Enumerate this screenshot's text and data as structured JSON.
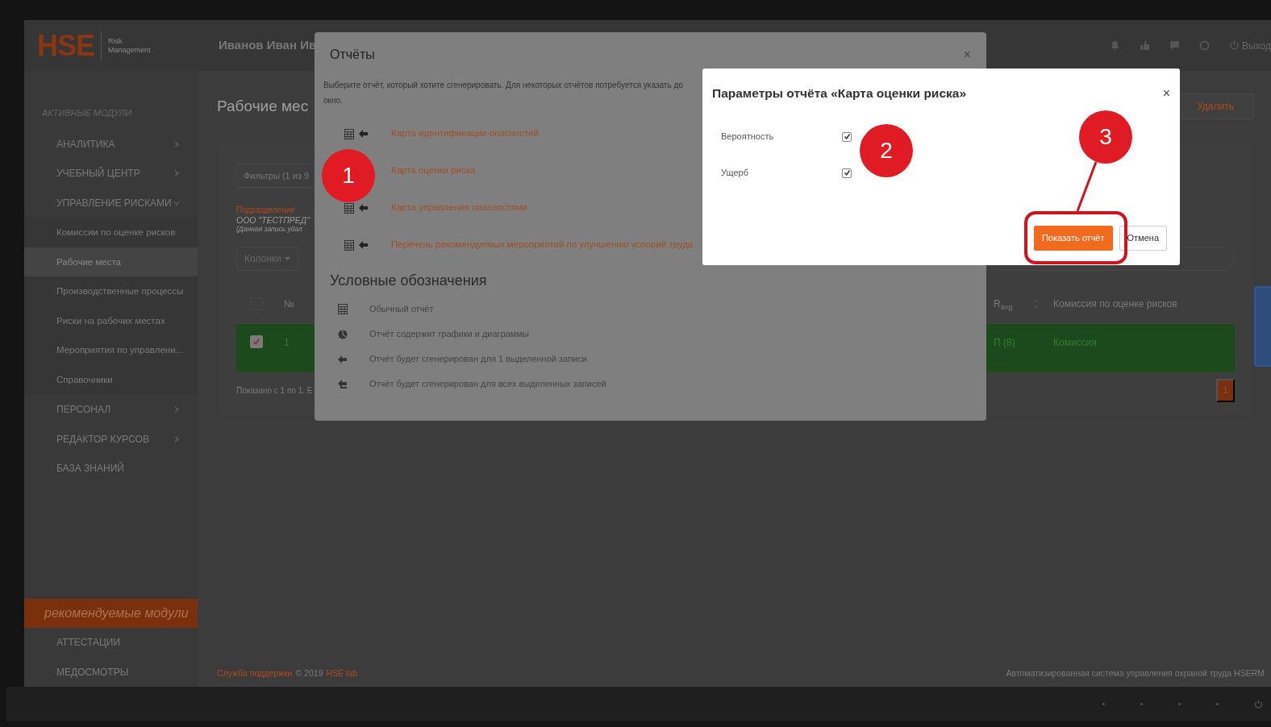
{
  "header": {
    "logo": "HSE",
    "logo_subtitle": [
      "Risk",
      "Management"
    ],
    "user": "Иванов Иван Ив",
    "logout": "Выход"
  },
  "sidebar": {
    "section_label": "АКТИВНЫЕ МОДУЛИ",
    "items": [
      {
        "label": "АНАЛИТИКА",
        "expanded": false,
        "selected": false
      },
      {
        "label": "УЧЕБНЫЙ ЦЕНТР",
        "expanded": false,
        "selected": false
      },
      {
        "label": "УПРАВЛЕНИЕ РИСКАМИ",
        "expanded": true,
        "selected": false,
        "children": [
          {
            "label": "Комиссии по оценке рисков",
            "selected": false
          },
          {
            "label": "Рабочие места",
            "selected": true
          },
          {
            "label": "Производственные процессы",
            "selected": false
          },
          {
            "label": "Риски на рабочих местах",
            "selected": false
          },
          {
            "label": "Мероприятия по управлени...",
            "selected": false
          },
          {
            "label": "Справочники",
            "selected": false
          }
        ]
      },
      {
        "label": "ПЕРСОНАЛ",
        "expanded": false,
        "selected": false
      },
      {
        "label": "РЕДАКТОР КУРСОВ",
        "expanded": false,
        "selected": false
      },
      {
        "label": "БАЗА ЗНАНИЙ",
        "selected": false
      }
    ],
    "recommended": {
      "label": "рекомендуемые модули",
      "items": [
        {
          "label": "АТТЕСТАЦИИ",
          "selected": false
        },
        {
          "label": "МЕДОСМОТРЫ",
          "selected": false
        }
      ]
    }
  },
  "page": {
    "title": "Рабочие мес",
    "delete_button": "Удалить",
    "filters_button": "Фильтры (1 из 9",
    "subdivision_label": "Подразделение",
    "subdivision_value": "ООО \"ТЕСТПРЕД\"",
    "subdivision_note": "(Данная запись удал",
    "columns_button": "Колонки",
    "table": {
      "header_checked": false,
      "columns": [
        "№",
        "R$_{avg}$",
        "Комиссия по оценке рисков"
      ],
      "rows": [
        {
          "selected": true,
          "checked": true,
          "cells": [
            "1",
            "П (8)",
            "Комиссия"
          ]
        }
      ]
    },
    "summary": "Показано с 1 по 1. Е",
    "pages": [
      {
        "label": "1",
        "selected": true
      }
    ]
  },
  "footer": {
    "support_link": "Служба поддержки",
    "copyright": "© 2019",
    "company_link": "HSE lab",
    "tagline": "Автоматизированная система управления охраной труда HSERM"
  },
  "reports_dialog": {
    "title": "Отчёты",
    "close": "×",
    "description_line1": "Выберите отчёт, который хотите сгенерировать. Для некоторых отчётов потребуется указать до",
    "description_line2": "окно.",
    "reports": [
      {
        "label": "Карта идентификации опасностей"
      },
      {
        "label": "Карта оценки риска"
      },
      {
        "label": "Карта управления опасностями"
      },
      {
        "label": "Перечень рекомендуемых мероприятий по улучшению условий труда"
      }
    ],
    "legend_title": "Условные обозначения",
    "legend": [
      {
        "kind": "table",
        "label": "Обычный отчёт"
      },
      {
        "kind": "chart",
        "label": "Отчёт содержит графики и диаграммы"
      },
      {
        "kind": "single",
        "label": "Отчёт будет сгенерирован для 1 выделенной записи"
      },
      {
        "kind": "multiple",
        "label": "Отчёт будет сгенерирован для всех выделенных записей"
      }
    ]
  },
  "params_dialog": {
    "title": "Параметры отчёта «Карта оценки риска»",
    "close": "×",
    "params": [
      {
        "label": "Вероятность",
        "checked": true
      },
      {
        "label": "Ущерб",
        "checked": true
      }
    ],
    "primary_button": "Показать отчёт",
    "cancel_button": "Отмена"
  },
  "callouts": [
    {
      "number": "1"
    },
    {
      "number": "2"
    },
    {
      "number": "3"
    }
  ]
}
